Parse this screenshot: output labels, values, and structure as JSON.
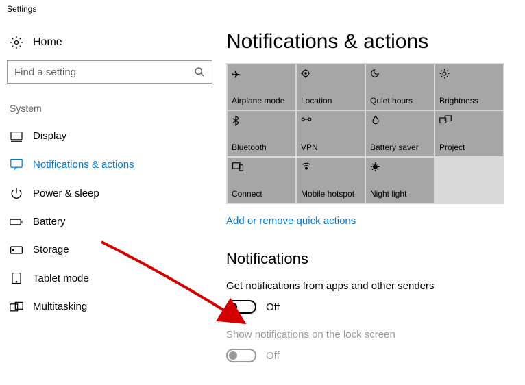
{
  "window": {
    "title": "Settings"
  },
  "sidebar": {
    "home_label": "Home",
    "search_placeholder": "Find a setting",
    "section_label": "System",
    "items": [
      {
        "label": "Display"
      },
      {
        "label": "Notifications & actions"
      },
      {
        "label": "Power & sleep"
      },
      {
        "label": "Battery"
      },
      {
        "label": "Storage"
      },
      {
        "label": "Tablet mode"
      },
      {
        "label": "Multitasking"
      }
    ]
  },
  "main": {
    "title": "Notifications & actions",
    "quick_actions": [
      {
        "label": "Airplane mode"
      },
      {
        "label": "Location"
      },
      {
        "label": "Quiet hours"
      },
      {
        "label": "Brightness"
      },
      {
        "label": "Bluetooth"
      },
      {
        "label": "VPN"
      },
      {
        "label": "Battery saver"
      },
      {
        "label": "Project"
      },
      {
        "label": "Connect"
      },
      {
        "label": "Mobile hotspot"
      },
      {
        "label": "Night light"
      }
    ],
    "link_text": "Add or remove quick actions",
    "notifications_heading": "Notifications",
    "setting1_label": "Get notifications from apps and other senders",
    "setting1_state": "Off",
    "setting2_label": "Show notifications on the lock screen",
    "setting2_state": "Off"
  }
}
